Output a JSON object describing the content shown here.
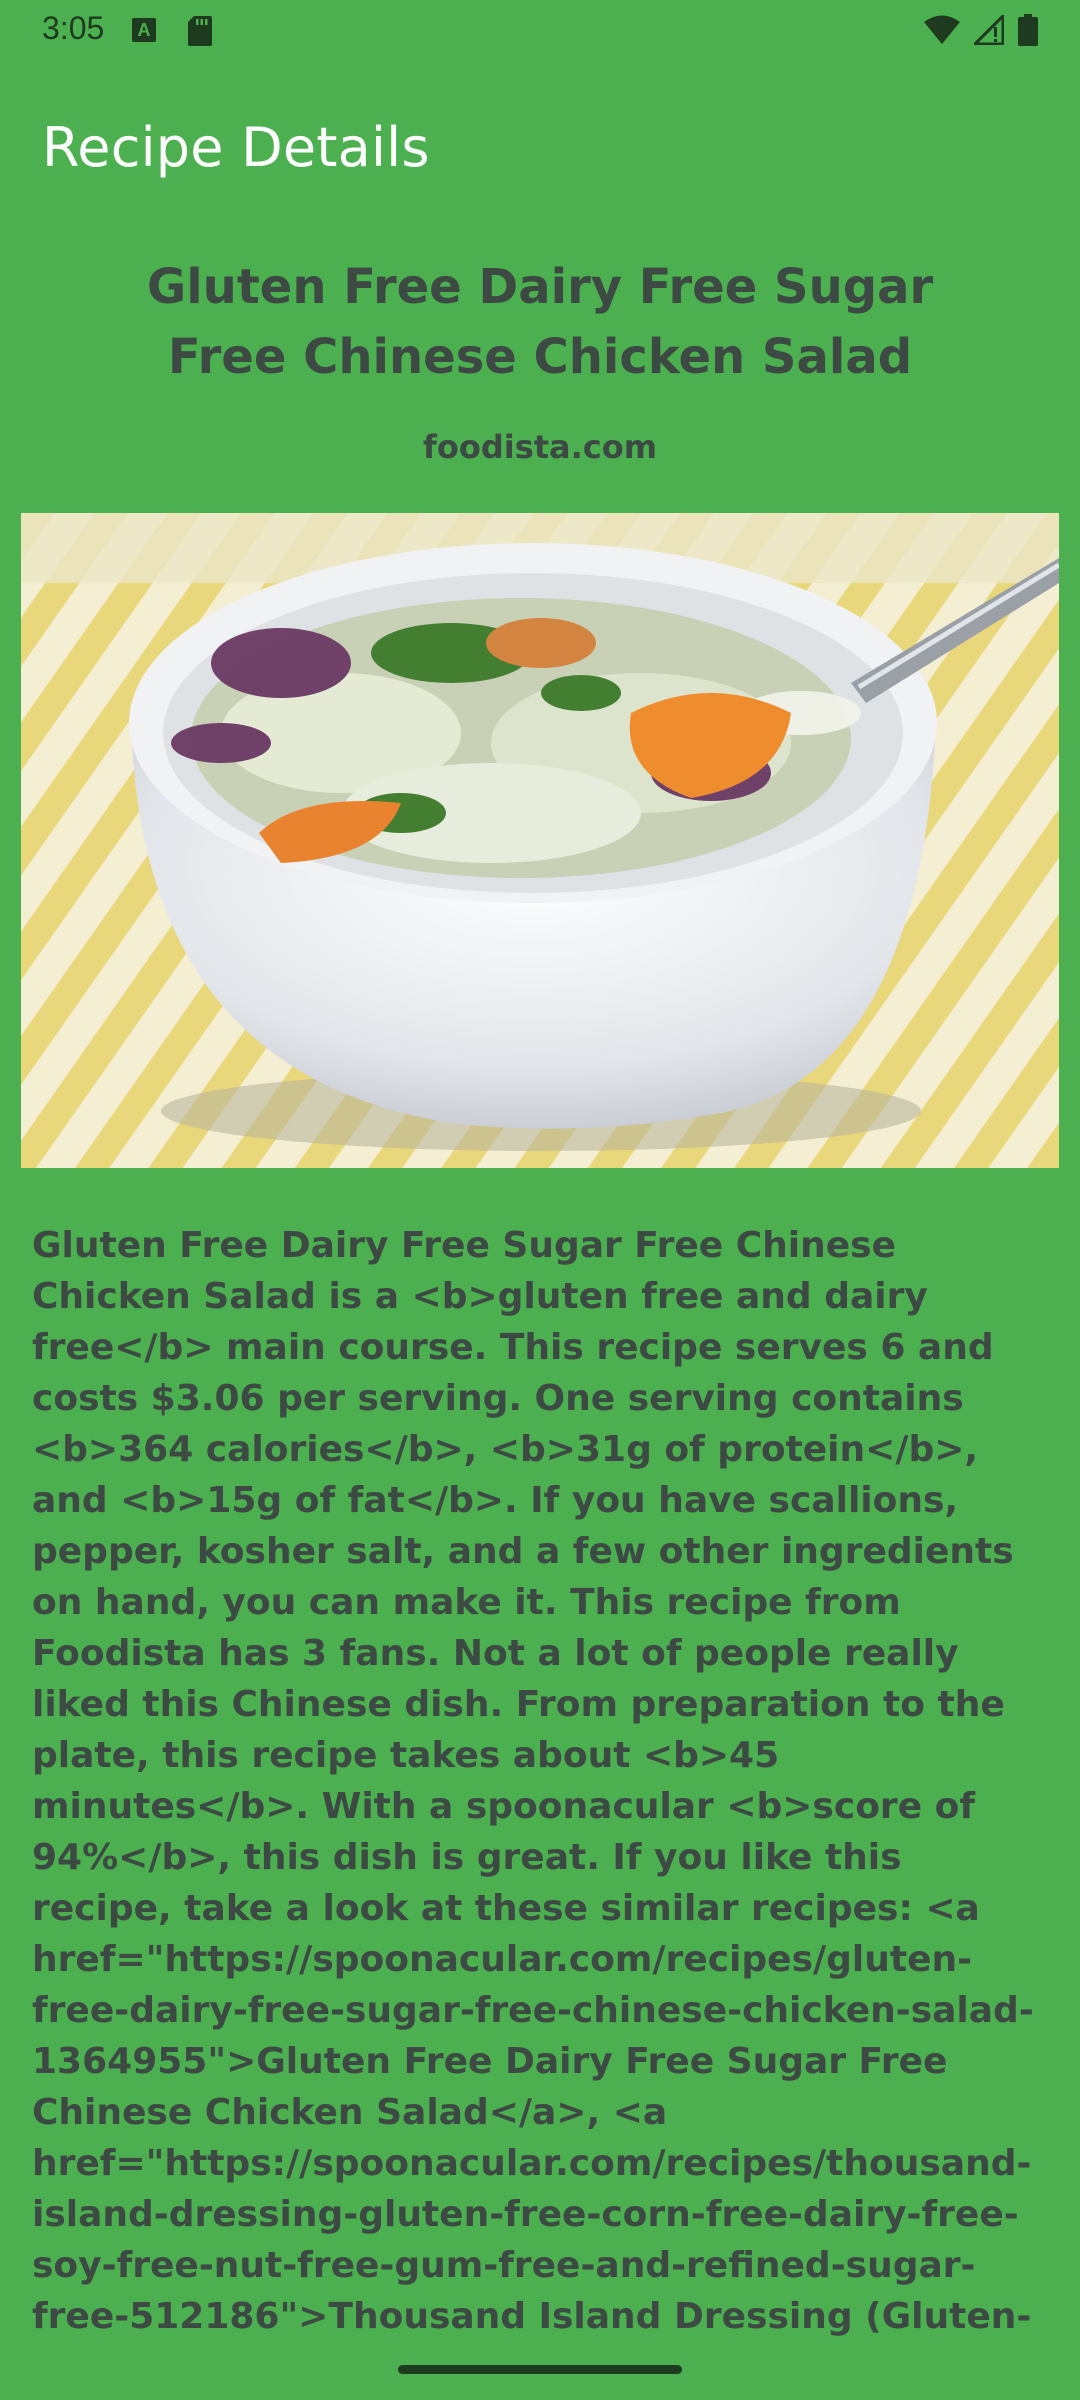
{
  "status_bar": {
    "time": "3:05",
    "notification_icons": [
      "a-icon",
      "sd-card-icon"
    ],
    "system_icons": [
      "wifi-icon",
      "cell-signal-icon",
      "battery-icon"
    ]
  },
  "app_bar": {
    "title": "Recipe Details"
  },
  "recipe": {
    "title": "Gluten Free Dairy Free Sugar Free Chinese Chicken Salad",
    "source": "foodista.com",
    "image": "recipe-photo",
    "summary": "Gluten Free Dairy Free Sugar Free Chinese Chicken Salad is a <b>gluten free and dairy free</b> main course. This recipe serves 6 and costs $3.06 per serving. One serving contains <b>364 calories</b>, <b>31g of protein</b>, and <b>15g of fat</b>. If you have scallions, pepper, kosher salt, and a few other ingredients on hand, you can make it. This recipe from Foodista has 3 fans. Not a lot of people really liked this Chinese dish. From preparation to the plate, this recipe takes about <b>45 minutes</b>. With a spoonacular <b>score of 94%</b>, this dish is great. If you like this recipe, take a look at these similar recipes: <a href=\"https://spoonacular.com/recipes/gluten-free-dairy-free-sugar-free-chinese-chicken-salad-1364955\">Gluten Free Dairy Free Sugar Free Chinese Chicken Salad</a>, <a href=\"https://spoonacular.com/recipes/thousand-island-dressing-gluten-free-corn-free-dairy-free-soy-free-nut-free-gum-free-and-refined-sugar-free-512186\">Thousand Island Dressing (Gluten-Free, Corn-Free, Dairy-Free, Soy-Free, Nut-Free, Gum-Free and Refined Sugar-Free)</a>, and <a href=\"https://"
  },
  "colors": {
    "background": "#4caf50",
    "title_text": "#ffffff",
    "body_text": "#3d4a44"
  }
}
